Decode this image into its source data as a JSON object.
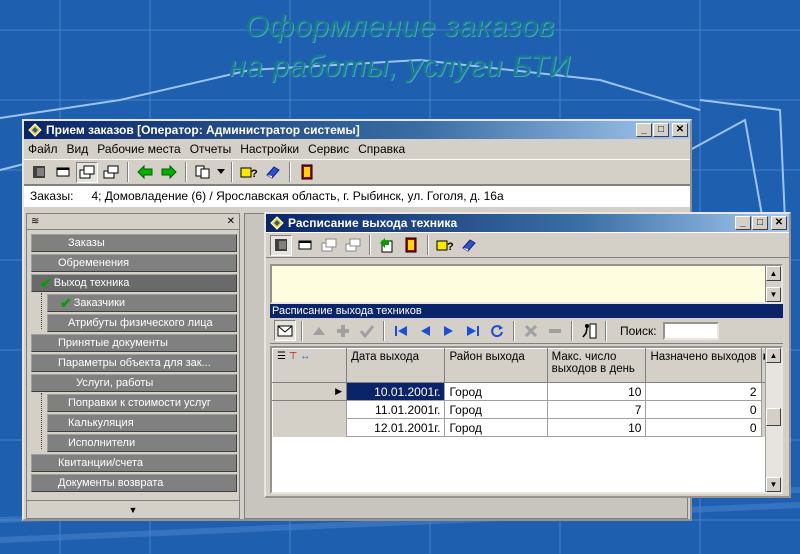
{
  "slide": {
    "title_line1": "Оформление заказов",
    "title_line2": "на работы, услуги БТИ"
  },
  "main_window": {
    "title": "Прием заказов [Оператор: Администратор системы]",
    "menu": [
      "Файл",
      "Вид",
      "Рабочие места",
      "Отчеты",
      "Настройки",
      "Сервис",
      "Справка"
    ],
    "order_label": "Заказы:",
    "order_value": "4; Домовладение (6) / Ярославская область, г. Рыбинск, ул. Гоголя, д. 16а",
    "nav_items": [
      {
        "label": "Заказы"
      },
      {
        "label": "Обременения"
      },
      {
        "label": "Выход техника"
      },
      {
        "label": "Заказчики"
      },
      {
        "label": "Атрибуты физического лица"
      },
      {
        "label": "Принятые документы"
      },
      {
        "label": "Параметры объекта для зак..."
      },
      {
        "label": "Услуги, работы"
      },
      {
        "label": "Поправки к стоимости услуг"
      },
      {
        "label": "Калькуляция"
      },
      {
        "label": "Исполнители"
      },
      {
        "label": "Квитанции/счета"
      },
      {
        "label": "Документы возврата"
      }
    ]
  },
  "schedule_window": {
    "title": "Расписание выхода техника",
    "subheader": "Расписание выхода техников",
    "search_label": "Поиск:",
    "search_value": "",
    "columns": [
      "Дата выхода",
      "Район выхода",
      "Макс. число выходов в день",
      "Назначено выходов"
    ],
    "rows": [
      {
        "date": "10.01.2001г.",
        "district": "Город",
        "max": "10",
        "assigned": "2"
      },
      {
        "date": "11.01.2001г.",
        "district": "Город",
        "max": "7",
        "assigned": "0"
      },
      {
        "date": "12.01.2001г.",
        "district": "Город",
        "max": "10",
        "assigned": "0"
      }
    ]
  },
  "colors": {
    "background": "#1f5fb0",
    "titlebar_active": "#0a246a",
    "window_face": "#d4d0c8",
    "nav_item": "#808080",
    "memo": "#fffde0"
  }
}
